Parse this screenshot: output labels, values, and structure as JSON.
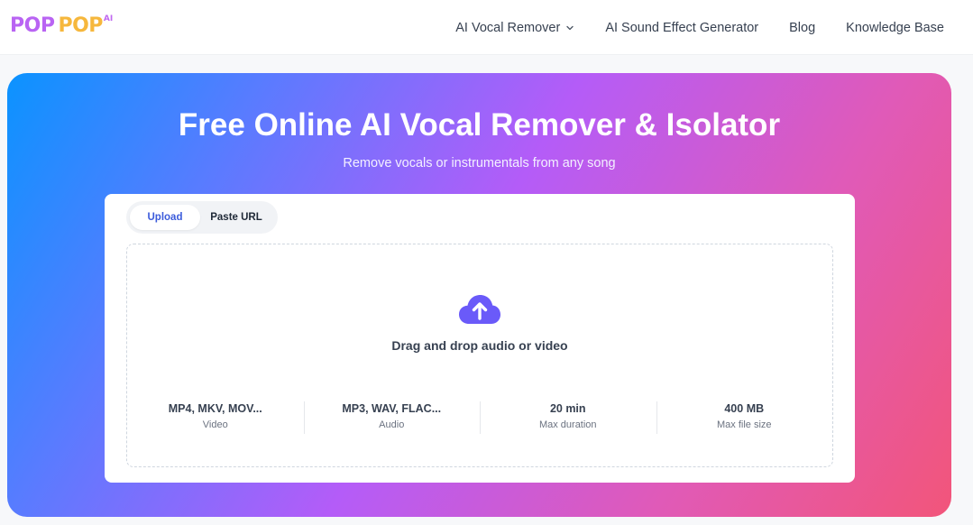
{
  "logo": {
    "part1": "POP",
    "part2": "POP",
    "suffix": "AI"
  },
  "nav": {
    "items": [
      {
        "label": "AI Vocal Remover",
        "has_dropdown": true
      },
      {
        "label": "AI Sound Effect Generator"
      },
      {
        "label": "Blog"
      },
      {
        "label": "Knowledge Base"
      }
    ]
  },
  "hero": {
    "title": "Free Online AI Vocal Remover & Isolator",
    "subtitle": "Remove vocals or instrumentals from any song"
  },
  "tabs": [
    {
      "label": "Upload",
      "active": true
    },
    {
      "label": "Paste URL",
      "active": false
    }
  ],
  "dropzone": {
    "icon": "cloud-upload-icon",
    "text": "Drag and drop audio or video"
  },
  "specs": [
    {
      "value": "MP4, MKV, MOV...",
      "label": "Video"
    },
    {
      "value": "MP3, WAV, FLAC...",
      "label": "Audio"
    },
    {
      "value": "20 min",
      "label": "Max duration"
    },
    {
      "value": "400 MB",
      "label": "Max file size"
    }
  ],
  "colors": {
    "accent": "#3b5bdb",
    "upload_icon": "#6a5af9",
    "gradient_start": "#0b93ff",
    "gradient_mid": "#b45cf8",
    "gradient_end": "#f2557a"
  }
}
